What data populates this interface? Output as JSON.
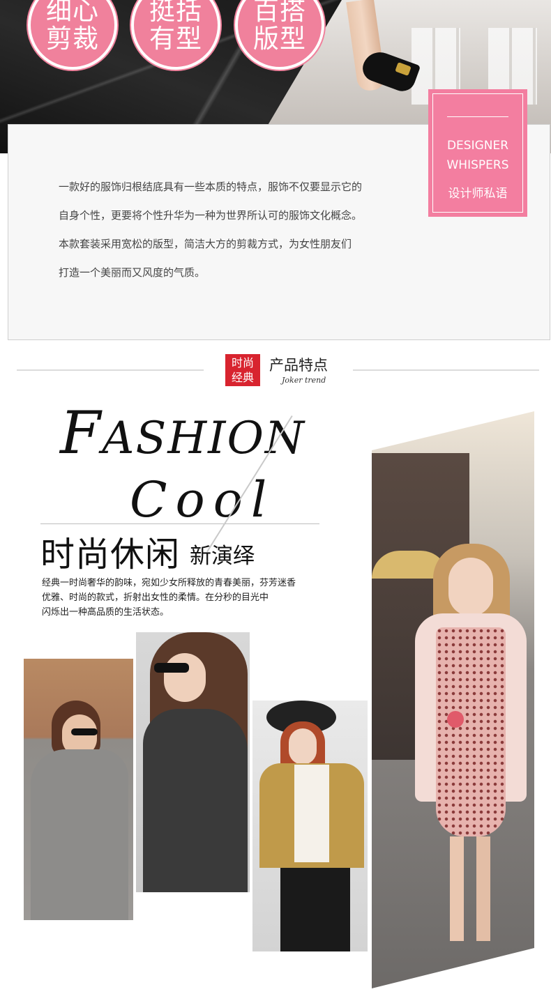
{
  "hero": {
    "badges": [
      {
        "line1": "细心",
        "line2": "剪裁"
      },
      {
        "line1": "挺括",
        "line2": "有型"
      },
      {
        "line1": "百搭",
        "line2": "版型"
      }
    ]
  },
  "whispers": {
    "tag_en_line1": "DESIGNER",
    "tag_en_line2": "WHISPERS",
    "tag_cn": "设计师私语",
    "paragraph": [
      "一款好的服饰归根结底具有一些本质的特点，服饰不仅要显示它的",
      "自身个性，更要将个性升华为一种为世界所认可的服饰文化概念。",
      "本款套装采用宽松的版型，简洁大方的剪裁方式，为女性朋友们",
      "打造一个美丽而又风度的气质。"
    ]
  },
  "section": {
    "badge_line1": "时尚",
    "badge_line2": "经典",
    "title": "产品特点",
    "subtitle": "Joker trend"
  },
  "feature": {
    "fashion_first": "F",
    "fashion_rest": "ASHION",
    "cool": "Cool",
    "headline": "时尚休闲",
    "headline_sub": "新演绎",
    "description": [
      "经典一时尚奢华的韵味，宛如少女所释放的青春美丽，芬芳迷香",
      "优雅、时尚的款式，折射出女性的柔情。在分秒的目光中",
      "闪烁出一种高品质的生活状态。"
    ]
  },
  "colors": {
    "pink_badge": "#f0819c",
    "pink_tag": "#f37ea0",
    "red_badge": "#d8242f"
  }
}
